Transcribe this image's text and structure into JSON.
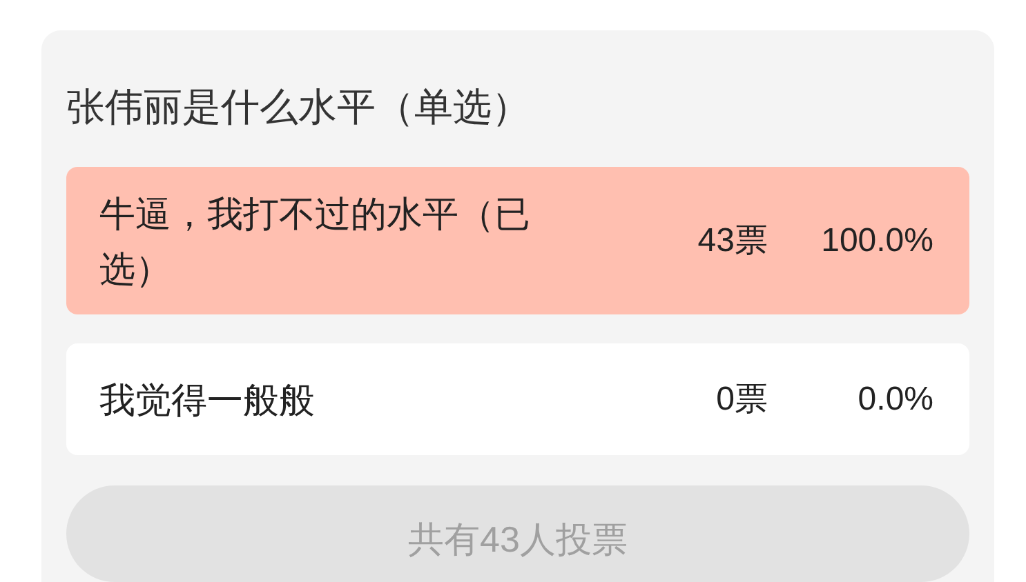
{
  "poll": {
    "title": "张伟丽是什么水平（单选）",
    "options": [
      {
        "label": "牛逼，我打不过的水平（已选）",
        "votes": "43票",
        "percent": "100.0%",
        "level": 1.0,
        "selected": true
      },
      {
        "label": "我觉得一般般",
        "votes": "0票",
        "percent": "0.0%",
        "level": 0.0,
        "selected": false
      }
    ],
    "total_button": {
      "label": "共有43人投票",
      "disabled": true
    }
  }
}
